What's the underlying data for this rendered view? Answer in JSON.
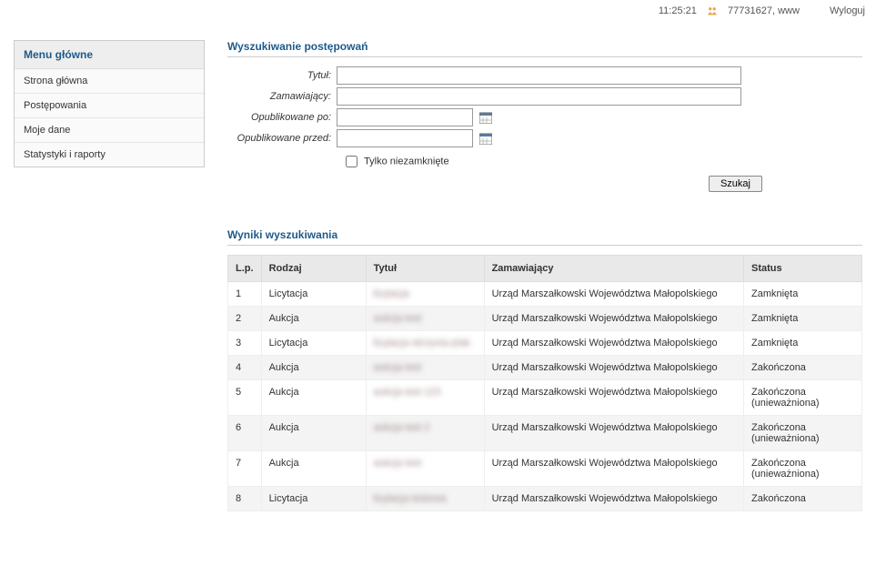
{
  "topbar": {
    "time": "11:25:21",
    "user_info": "77731627, www",
    "logout": "Wyloguj"
  },
  "sidebar": {
    "title": "Menu główne",
    "items": [
      {
        "label": "Strona główna"
      },
      {
        "label": "Postępowania"
      },
      {
        "label": "Moje dane"
      },
      {
        "label": "Statystyki i raporty"
      }
    ]
  },
  "search_form": {
    "title": "Wyszukiwanie postępowań",
    "fields": {
      "title_label": "Tytuł:",
      "title_value": "",
      "ordering_label": "Zamawiający:",
      "ordering_value": "",
      "published_after_label": "Opublikowane po:",
      "published_after_value": "",
      "published_before_label": "Opublikowane przed:",
      "published_before_value": "",
      "only_open_label": "Tylko niezamknięte"
    },
    "search_button": "Szukaj"
  },
  "results": {
    "title": "Wyniki wyszukiwania",
    "columns": {
      "lp": "L.p.",
      "rodzaj": "Rodzaj",
      "tytul": "Tytuł",
      "zamawiajacy": "Zamawiający",
      "status": "Status"
    },
    "rows": [
      {
        "lp": "1",
        "rodzaj": "Licytacja",
        "tytul": "licytacja",
        "zamawiajacy": "Urząd Marszałkowski Województwa Małopolskiego",
        "status": "Zamknięta"
      },
      {
        "lp": "2",
        "rodzaj": "Aukcja",
        "tytul": "aukcja test",
        "zamawiajacy": "Urząd Marszałkowski Województwa Małopolskiego",
        "status": "Zamknięta"
      },
      {
        "lp": "3",
        "rodzaj": "Licytacja",
        "tytul": "licytacja skrzynia ptak",
        "zamawiajacy": "Urząd Marszałkowski Województwa Małopolskiego",
        "status": "Zamknięta"
      },
      {
        "lp": "4",
        "rodzaj": "Aukcja",
        "tytul": "aukcja test",
        "zamawiajacy": "Urząd Marszałkowski Województwa Małopolskiego",
        "status": "Zakończona"
      },
      {
        "lp": "5",
        "rodzaj": "Aukcja",
        "tytul": "aukcja test 123",
        "zamawiajacy": "Urząd Marszałkowski Województwa Małopolskiego",
        "status": "Zakończona (unieważniona)"
      },
      {
        "lp": "6",
        "rodzaj": "Aukcja",
        "tytul": "aukcja test 2",
        "zamawiajacy": "Urząd Marszałkowski Województwa Małopolskiego",
        "status": "Zakończona (unieważniona)"
      },
      {
        "lp": "7",
        "rodzaj": "Aukcja",
        "tytul": "aukcja test",
        "zamawiajacy": "Urząd Marszałkowski Województwa Małopolskiego",
        "status": "Zakończona (unieważniona)"
      },
      {
        "lp": "8",
        "rodzaj": "Licytacja",
        "tytul": "licytacja testowa",
        "zamawiajacy": "Urząd Marszałkowski Województwa Małopolskiego",
        "status": "Zakończona"
      }
    ]
  }
}
